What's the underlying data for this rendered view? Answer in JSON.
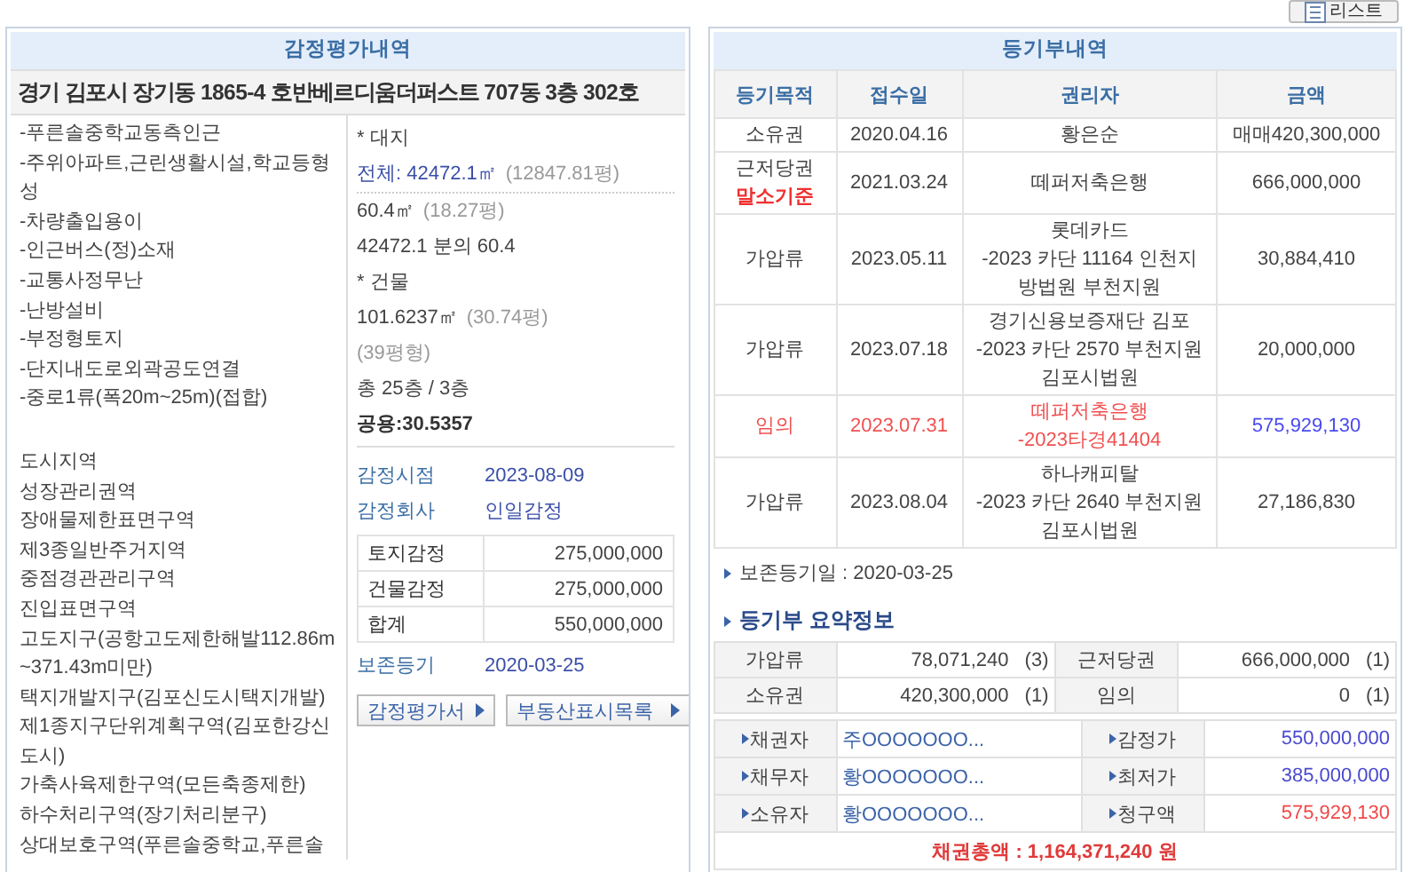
{
  "top_button": {
    "label": "리스트"
  },
  "appraisal": {
    "title": "감정평가내역",
    "address": "경기 김포시 장기동 1865-4 호반베르디움더퍼스트 707동 3층 302호",
    "features": [
      "-푸른솔중학교동측인근",
      "-주위아파트,근린생활시설,학교등형성",
      "-차량출입용이",
      "-인근버스(정)소재",
      "-교통사정무난",
      "-난방설비",
      "-부정형토지",
      "-단지내도로외곽공도연결",
      "-중로1류(폭20m~25m)(접합)"
    ],
    "zoning": [
      "도시지역",
      "성장관리권역",
      "장애물제한표면구역",
      "제3종일반주거지역",
      "중점경관관리구역",
      "진입표면구역",
      "고도지구(공항고도제한해발112.86m~371.43m미만)",
      "택지개발지구(김포신도시택지개발)",
      "제1종지구단위계획구역(김포한강신도시)",
      "가축사육제한구역(모든축종제한)",
      "하수처리구역(장기처리분구)",
      "상대보호구역(푸른솔중학교,푸른솔"
    ],
    "details": [
      {
        "kind": "heading",
        "text": "* 대지"
      },
      {
        "kind": "total",
        "text": "전체: 42472.1㎡",
        "note": "(12847.81평)"
      },
      {
        "kind": "plain",
        "text": "60.4㎡",
        "note": "(18.27평)"
      },
      {
        "kind": "plain",
        "text": "42472.1 분의 60.4"
      },
      {
        "kind": "heading",
        "text": "* 건물"
      },
      {
        "kind": "plain",
        "text": "101.6237㎡",
        "note": "(30.74평)"
      },
      {
        "kind": "note",
        "text": "(39평형)"
      },
      {
        "kind": "plain",
        "text": "총 25층 / 3층"
      },
      {
        "kind": "bold",
        "text": "공용:30.5357"
      }
    ],
    "info": [
      {
        "label": "감정시점",
        "value": "2023-08-09"
      },
      {
        "label": "감정회사",
        "value": "인일감정"
      }
    ],
    "values": [
      {
        "label": "토지감정",
        "value": "275,000,000"
      },
      {
        "label": "건물감정",
        "value": "275,000,000"
      },
      {
        "label": "합계",
        "value": "550,000,000"
      }
    ],
    "preservation": {
      "label": "보존등기",
      "value": "2020-03-25"
    },
    "buttons": [
      "감정평가서",
      "부동산표시목록"
    ]
  },
  "registry": {
    "title": "등기부내역",
    "columns": [
      "등기목적",
      "접수일",
      "권리자",
      "금액"
    ],
    "rows": [
      {
        "kind": "normal",
        "purpose": "소유권",
        "date": "2020.04.16",
        "holder": [
          "황은순"
        ],
        "amount": "매매420,300,000"
      },
      {
        "kind": "normal",
        "purpose": "근저당권",
        "tag": "말소기준",
        "date": "2021.03.24",
        "holder": [
          "떼퍼저축은행"
        ],
        "amount": "666,000,000"
      },
      {
        "kind": "normal",
        "purpose": "가압류",
        "date": "2023.05.11",
        "holder": [
          "롯데카드",
          "-2023 카단 11164 인천지",
          "방법원 부천지원"
        ],
        "amount": "30,884,410"
      },
      {
        "kind": "normal",
        "purpose": "가압류",
        "date": "2023.07.18",
        "holder": [
          "경기신용보증재단 김포",
          "-2023 카단 2570 부천지원",
          "김포시법원"
        ],
        "amount": "20,000,000"
      },
      {
        "kind": "auction",
        "purpose": "임의",
        "date": "2023.07.31",
        "holder": [
          "떼퍼저축은행",
          "-2023타경41404"
        ],
        "amount": "575,929,130"
      },
      {
        "kind": "normal",
        "purpose": "가압류",
        "date": "2023.08.04",
        "holder": [
          "하나캐피탈",
          "-2023 카단 2640 부천지원",
          "김포시법원"
        ],
        "amount": "27,186,830"
      }
    ],
    "preservation_date": "보존등기일 : 2020-03-25"
  },
  "summary": {
    "title": "등기부 요약정보",
    "totals": [
      {
        "label": "가압류",
        "amount": "78,071,240",
        "count": "(3)"
      },
      {
        "label": "근저당권",
        "amount": "666,000,000",
        "count": "(1)"
      },
      {
        "label": "소유권",
        "amount": "420,300,000",
        "count": "(1)"
      },
      {
        "label": "임의",
        "amount": "0",
        "count": "(1)"
      }
    ],
    "parties": [
      {
        "label": "채권자",
        "value": "주OOOOOOO...",
        "price_label": "감정가",
        "price": "550,000,000",
        "color": "#4a4acf"
      },
      {
        "label": "채무자",
        "value": "황OOOOOOO...",
        "price_label": "최저가",
        "price": "385,000,000",
        "color": "#4a4acf"
      },
      {
        "label": "소유자",
        "value": "황OOOOOOO...",
        "price_label": "청구액",
        "price": "575,929,130",
        "color": "#f04848"
      }
    ],
    "total": "채권총액 : 1,164,371,240 원"
  }
}
